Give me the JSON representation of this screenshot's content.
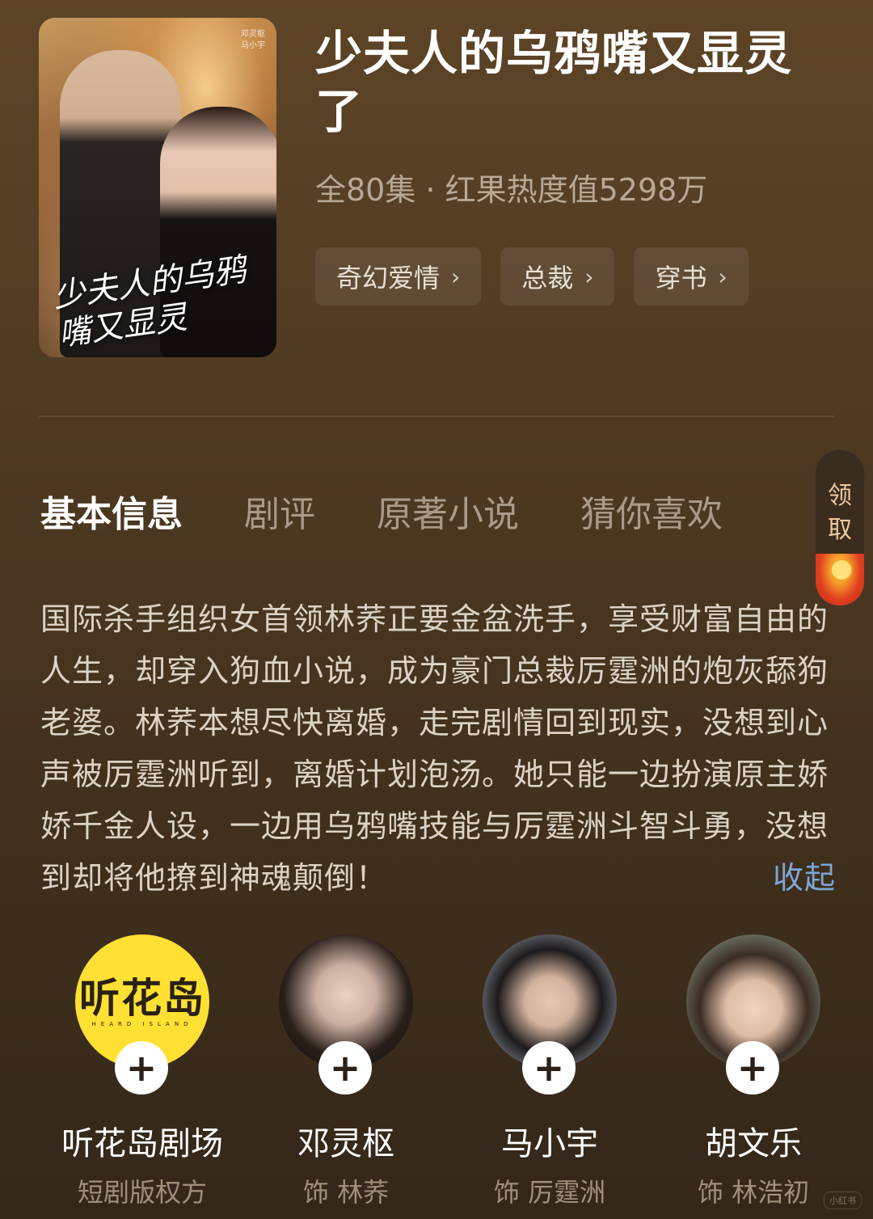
{
  "drama": {
    "title": "少夫人的乌鸦嘴又显灵了",
    "meta": "全80集 · 红果热度值5298万",
    "poster": {
      "title": "少夫人的乌鸦嘴又显灵",
      "credit_line1": "邓灵枢",
      "credit_line2": "马小宇"
    },
    "tags": [
      {
        "label": "奇幻爱情"
      },
      {
        "label": "总裁"
      },
      {
        "label": "穿书"
      }
    ]
  },
  "tabs": [
    {
      "label": "基本信息",
      "active": true
    },
    {
      "label": "剧评",
      "active": false
    },
    {
      "label": "原著小说",
      "active": false
    },
    {
      "label": "猜你喜欢",
      "active": false
    }
  ],
  "claim_widget": {
    "label_line1": "领",
    "label_line2": "取",
    "icon": "red-envelope-icon"
  },
  "synopsis": {
    "text": "国际杀手组织女首领林荞正要金盆洗手，享受财富自由的人生，却穿入狗血小说，成为豪门总裁厉霆洲的炮灰舔狗老婆。林荞本想尽快离婚，走完剧情回到现实，没想到心声被厉霆洲听到，离婚计划泡汤。她只能一边扮演原主娇娇千金人设，一边用乌鸦嘴技能与厉霆洲斗智斗勇，没想到却将他撩到神魂颠倒！",
    "collapse_label": "收起"
  },
  "cast": [
    {
      "name": "听花岛剧场",
      "role": "短剧版权方",
      "logo_text": "听花岛",
      "logo_sub": "HEARD ISLAND"
    },
    {
      "name": "邓灵枢",
      "role": "饰 林荞"
    },
    {
      "name": "马小宇",
      "role": "饰 厉霆洲"
    },
    {
      "name": "胡文乐",
      "role": "饰 林浩初"
    }
  ],
  "follow_icon": "+",
  "chevron": "›",
  "watermark": "小红书",
  "colors": {
    "background": "#4e3a22",
    "accent_link": "#7ea6d6",
    "logo_yellow": "#ffe033"
  }
}
